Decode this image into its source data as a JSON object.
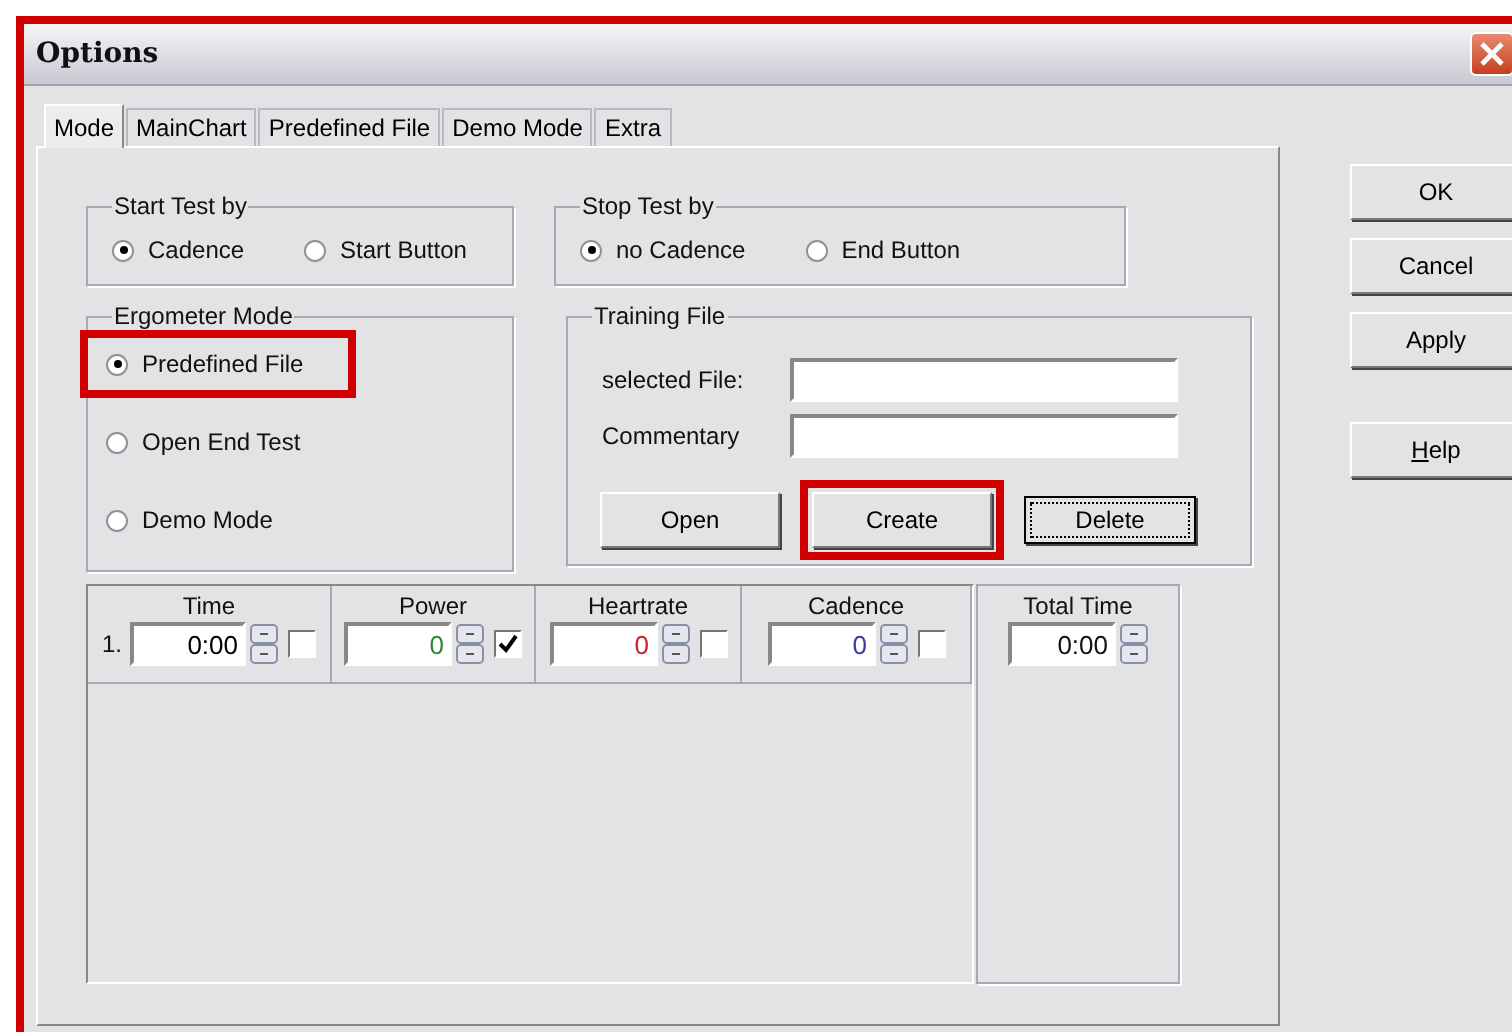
{
  "window": {
    "title": "Options"
  },
  "tabs": [
    {
      "label": "Mode",
      "selected": true
    },
    {
      "label": "MainChart",
      "selected": false
    },
    {
      "label": "Predefined File",
      "selected": false
    },
    {
      "label": "Demo Mode",
      "selected": false
    },
    {
      "label": "Extra",
      "selected": false
    }
  ],
  "start_test": {
    "title": "Start Test by",
    "options": [
      {
        "label": "Cadence",
        "selected": true
      },
      {
        "label": "Start Button",
        "selected": false
      }
    ]
  },
  "stop_test": {
    "title": "Stop Test by",
    "options": [
      {
        "label": "no Cadence",
        "selected": true
      },
      {
        "label": "End Button",
        "selected": false
      }
    ]
  },
  "ergometer_mode": {
    "title": "Ergometer Mode",
    "options": [
      {
        "label": "Predefined File",
        "selected": true,
        "highlighted": true
      },
      {
        "label": "Open End Test",
        "selected": false,
        "highlighted": false
      },
      {
        "label": "Demo Mode",
        "selected": false,
        "highlighted": false
      }
    ]
  },
  "training_file": {
    "title": "Training File",
    "fields": [
      {
        "label": "selected File:"
      },
      {
        "label": "Commentary"
      }
    ],
    "buttons": [
      {
        "label": "Open",
        "highlighted": false,
        "focused": false
      },
      {
        "label": "Create",
        "highlighted": true,
        "focused": false
      },
      {
        "label": "Delete",
        "highlighted": false,
        "focused": true
      }
    ]
  },
  "schedule": {
    "row_number": "1.",
    "columns": [
      {
        "title": "Time",
        "value": "0:00",
        "color": "#000000",
        "checked": false
      },
      {
        "title": "Power",
        "value": "0",
        "color": "#2e8b2e",
        "checked": true
      },
      {
        "title": "Heartrate",
        "value": "0",
        "color": "#d02030",
        "checked": false
      },
      {
        "title": "Cadence",
        "value": "0",
        "color": "#3a3aa0",
        "checked": false
      }
    ]
  },
  "total_time": {
    "title": "Total Time",
    "value": "0:00"
  },
  "buttons": [
    {
      "label": "OK",
      "mnemonic": false
    },
    {
      "label": "Cancel",
      "mnemonic": false
    },
    {
      "label": "Apply",
      "mnemonic": false
    },
    {
      "label": "Help",
      "mnemonic": true
    }
  ]
}
